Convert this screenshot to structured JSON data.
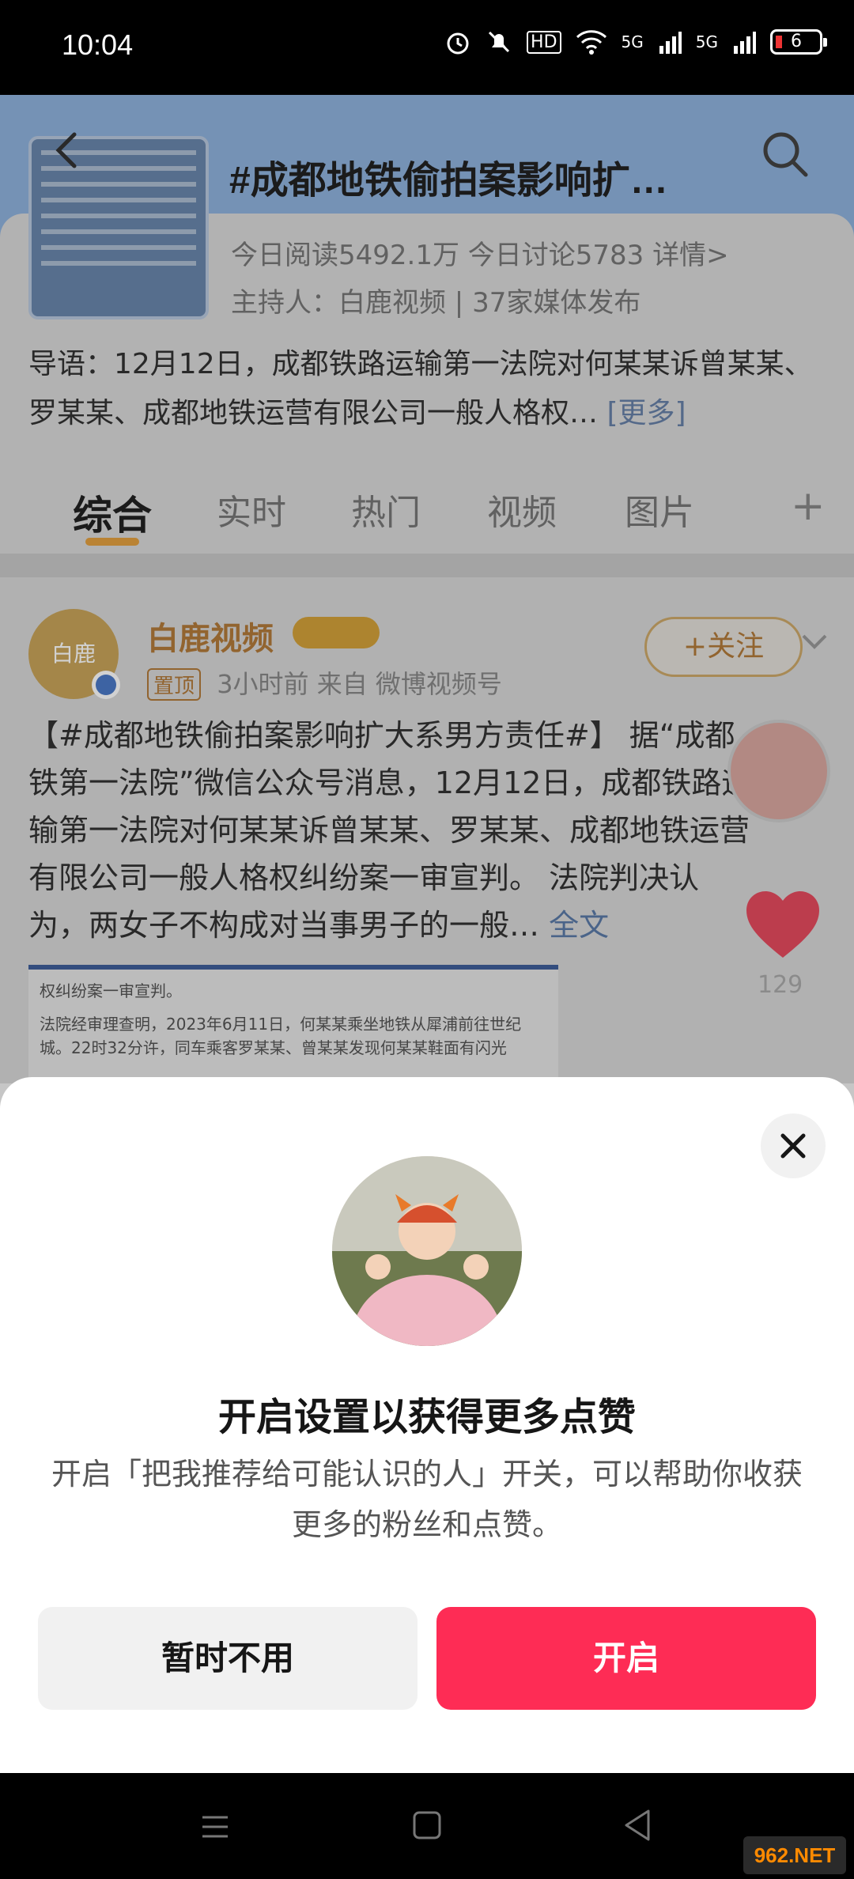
{
  "status_bar": {
    "time": "10:04",
    "hd_label": "HD",
    "network_1": "5G",
    "network_2": "5G",
    "battery_level": "6"
  },
  "topic": {
    "title": "#成都地铁偷拍案影响扩…",
    "stats": "今日阅读5492.1万  今日讨论5783  详情>",
    "host": "主持人：白鹿视频 | 37家媒体发布",
    "intro": "导语：12月12日，成都铁路运输第一法院对何某某诉曾某某、罗某某、成都地铁运营有限公司一般人格权…",
    "intro_more": "[更多]",
    "tabs": [
      {
        "label": "综合"
      },
      {
        "label": "实时"
      },
      {
        "label": "热门"
      },
      {
        "label": "视频"
      },
      {
        "label": "图片"
      }
    ],
    "tab_plus": "+"
  },
  "post": {
    "avatar_text": "白鹿",
    "author": "白鹿视频",
    "pin_tag": "置顶",
    "meta": "3小时前  来自 微博视频号",
    "follow_label": "+关注",
    "text": "【#成都地铁偷拍案影响扩大系男方责任#】 据“成都铁第一法院”微信公众号消息，12月12日，成都铁路运输第一法院对何某某诉曾某某、罗某某、成都地铁运营有限公司一般人格权纠纷案一审宣判。 法院判决认为，两女子不构成对当事男子的一般…",
    "text_full": "全文",
    "image_caption_1": "权纠纷案一审宣判。",
    "image_caption_2": "法院经审理查明，2023年6月11日，何某某乘坐地铁从犀浦前往世纪城。22时32分许，同车乘客罗某某、曾某某发现何某某鞋面有闪光",
    "like_count": "129"
  },
  "sheet": {
    "title": "开启设置以获得更多点赞",
    "description": "开启「把我推荐给可能认识的人」开关，可以帮助你收获更多的粉丝和点赞。",
    "secondary_button": "暂时不用",
    "primary_button": "开启"
  },
  "watermark": "962.NET",
  "colors": {
    "primary": "#fe2c55",
    "secondary_bg": "#f1f1f1",
    "topic_header": "#8fb2dd"
  },
  "icons": [
    "back-icon",
    "search-icon",
    "close-icon",
    "heart-icon",
    "menu-icon",
    "home-icon",
    "back-nav-icon"
  ]
}
